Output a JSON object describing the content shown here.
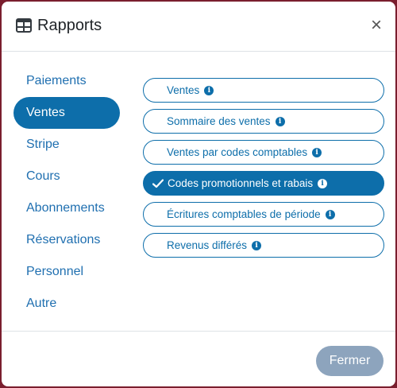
{
  "header": {
    "title": "Rapports",
    "close_label": "×"
  },
  "nav": {
    "items": [
      {
        "label": "Paiements",
        "active": false
      },
      {
        "label": "Ventes",
        "active": true
      },
      {
        "label": "Stripe",
        "active": false
      },
      {
        "label": "Cours",
        "active": false
      },
      {
        "label": "Abonnements",
        "active": false
      },
      {
        "label": "Réservations",
        "active": false
      },
      {
        "label": "Personnel",
        "active": false
      },
      {
        "label": "Autre",
        "active": false
      }
    ]
  },
  "reports": {
    "items": [
      {
        "label": "Ventes",
        "selected": false
      },
      {
        "label": "Sommaire des ventes",
        "selected": false
      },
      {
        "label": "Ventes par codes comptables",
        "selected": false
      },
      {
        "label": "Codes promotionnels et rabais",
        "selected": true
      },
      {
        "label": "Écritures comptables de période",
        "selected": false
      },
      {
        "label": "Revenus différés",
        "selected": false
      }
    ],
    "info_glyph": "i"
  },
  "footer": {
    "close_button": "Fermer"
  },
  "colors": {
    "accent": "#0d6eaa",
    "button_disabled": "#8da4bd",
    "backdrop": "#7a1e2e"
  }
}
